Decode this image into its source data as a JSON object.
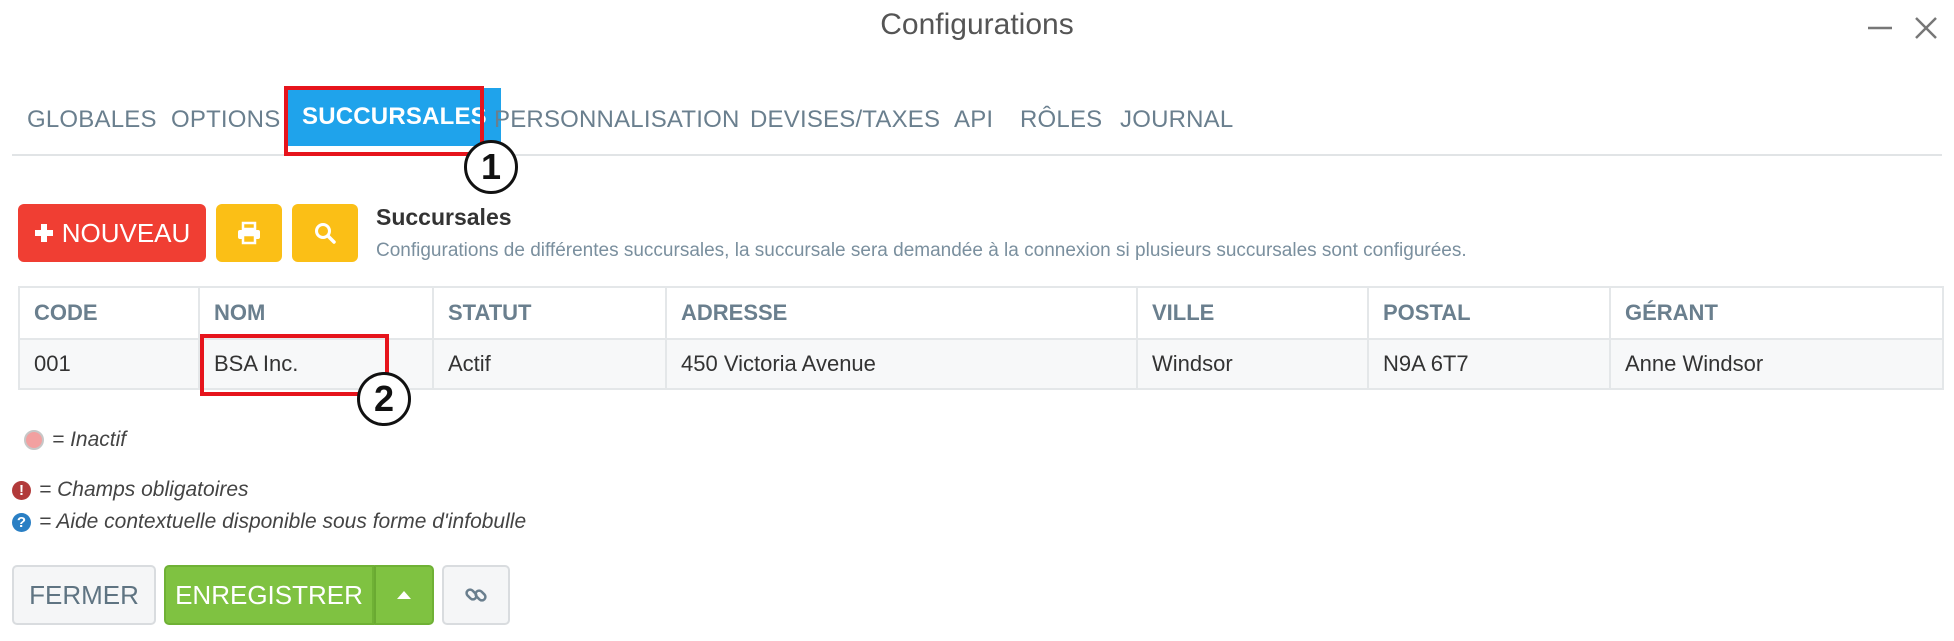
{
  "window": {
    "title": "Configurations",
    "minimize_icon": "minimize-icon",
    "close_icon": "close-icon"
  },
  "tabs": [
    {
      "label": "GLOBALES"
    },
    {
      "label": "OPTIONS"
    },
    {
      "label": "SUCCURSALES",
      "active": true
    },
    {
      "label": "PERSONNALISATION"
    },
    {
      "label": "DEVISES/TAXES"
    },
    {
      "label": "API"
    },
    {
      "label": "RÔLES"
    },
    {
      "label": "JOURNAL"
    }
  ],
  "toolbar": {
    "new_label": "NOUVEAU",
    "new_icon": "plus-icon",
    "print_icon": "print-icon",
    "search_icon": "search-icon"
  },
  "section": {
    "title": "Succursales",
    "description": "Configurations de différentes succursales, la succursale sera demandée à la connexion si plusieurs succursales sont configurées."
  },
  "table": {
    "columns": [
      "CODE",
      "NOM",
      "STATUT",
      "ADRESSE",
      "VILLE",
      "POSTAL",
      "GÉRANT"
    ],
    "rows": [
      [
        "001",
        "BSA Inc.",
        "Actif",
        "450 Victoria Avenue",
        "Windsor",
        "N9A 6T7",
        "Anne Windsor"
      ]
    ]
  },
  "legend": {
    "inactive": "= Inactif",
    "required": "= Champs obligatoires",
    "help": "= Aide contextuelle disponible sous forme d'infobulle"
  },
  "footer": {
    "close_label": "FERMER",
    "save_label": "ENREGISTRER",
    "caret_icon": "caret-up-icon",
    "link_icon": "link-icon"
  },
  "annotations": [
    "1",
    "2"
  ],
  "colors": {
    "accent": "#1fa3eb",
    "danger": "#f03e33",
    "warning": "#fbbf16",
    "success": "#7fc241",
    "annotation": "#e6141c"
  }
}
